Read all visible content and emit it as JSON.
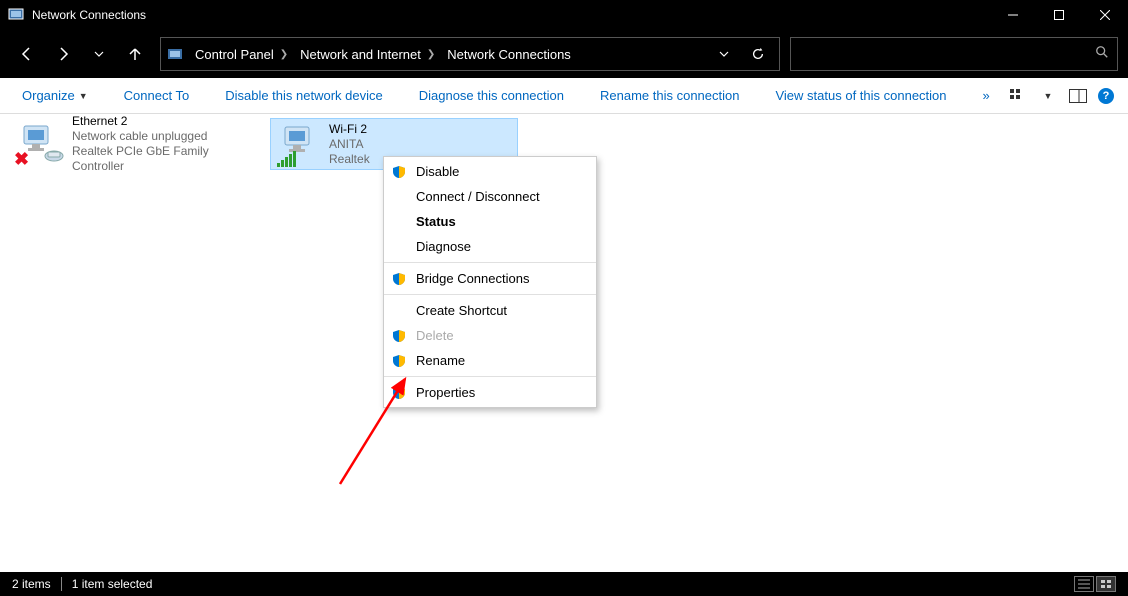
{
  "window": {
    "title": "Network Connections"
  },
  "breadcrumbs": [
    "Control Panel",
    "Network and Internet",
    "Network Connections"
  ],
  "toolbar": {
    "organize": "Organize",
    "connect_to": "Connect To",
    "disable": "Disable this network device",
    "diagnose": "Diagnose this connection",
    "rename": "Rename this connection",
    "view_status": "View status of this connection"
  },
  "connections": [
    {
      "name": "Ethernet 2",
      "status": "Network cable unplugged",
      "adapter": "Realtek PCIe GbE Family Controller",
      "selected": false,
      "type": "ethernet"
    },
    {
      "name": "Wi-Fi 2",
      "status": "ANITA",
      "adapter": "Realtek ",
      "selected": true,
      "type": "wifi"
    }
  ],
  "context_menu": {
    "disable": "Disable",
    "connect_disconnect": "Connect / Disconnect",
    "status": "Status",
    "diagnose": "Diagnose",
    "bridge": "Bridge Connections",
    "shortcut": "Create Shortcut",
    "delete": "Delete",
    "rename": "Rename",
    "properties": "Properties"
  },
  "statusbar": {
    "items_count": "2 items",
    "selected_count": "1 item selected"
  }
}
